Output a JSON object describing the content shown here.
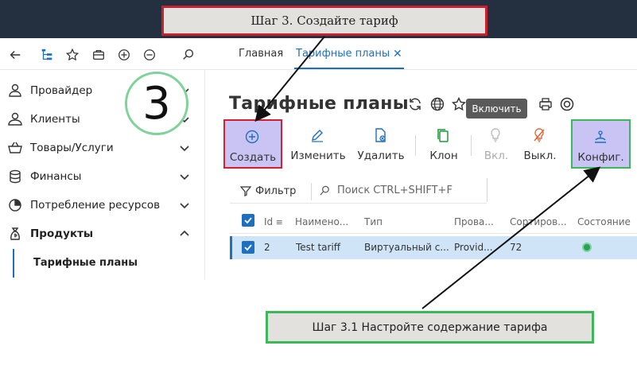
{
  "tabs": [
    {
      "label": "Главная",
      "active": false
    },
    {
      "label": "Тарифные планы",
      "active": true
    }
  ],
  "tab_close": "✕",
  "sidebar": {
    "items": [
      {
        "label": "Провайдер",
        "icon": "user-shield-icon",
        "expanded": false
      },
      {
        "label": "Клиенты",
        "icon": "users-icon",
        "expanded": false
      },
      {
        "label": "Товары/Услуги",
        "icon": "basket-icon",
        "expanded": false
      },
      {
        "label": "Финансы",
        "icon": "coins-icon",
        "expanded": false
      },
      {
        "label": "Потребление ресурсов",
        "icon": "pie-chart-icon",
        "expanded": false
      },
      {
        "label": "Продукты",
        "icon": "money-bag-icon",
        "expanded": true
      }
    ],
    "sub_item": "Тарифные планы"
  },
  "page": {
    "title": "Тарифные планы"
  },
  "tooltip": "Включить",
  "actions": [
    {
      "label": "Создать",
      "icon": "plus-circle-icon",
      "enabled": true
    },
    {
      "label": "Изменить",
      "icon": "pencil-icon",
      "enabled": true
    },
    {
      "label": "Удалить",
      "icon": "file-delete-icon",
      "enabled": true
    },
    {
      "label": "Клон",
      "icon": "copy-icon",
      "enabled": true
    },
    {
      "label": "Вкл.",
      "icon": "bulb-on-icon",
      "enabled": false
    },
    {
      "label": "Выкл.",
      "icon": "bulb-off-icon",
      "enabled": true
    },
    {
      "label": "Конфиг.",
      "icon": "config-icon",
      "enabled": true
    }
  ],
  "filter": {
    "label": "Фильтр",
    "search_placeholder": "Поиск CTRL+SHIFT+F"
  },
  "table": {
    "columns": [
      "Id",
      "Наимено...",
      "Тип",
      "Прова...",
      "Сортиров...",
      "Состояние"
    ],
    "rows": [
      {
        "id": "2",
        "name": "Test tariff",
        "type": "Виртуальный с...",
        "provider": "Provid...",
        "sort": "72",
        "status": "active"
      }
    ]
  },
  "annotations": {
    "step_number": "3",
    "top_callout": "Шаг 3. Создайте тариф",
    "bottom_callout": "Шаг 3.1 Настройте содержание тарифа"
  },
  "colors": {
    "accent": "#1d6fc1",
    "topbar": "#243040",
    "highlight_fill": "#c9c4f3",
    "red_border": "#d42030",
    "green_border": "#3cb85a",
    "status_green": "#2aa05a"
  }
}
